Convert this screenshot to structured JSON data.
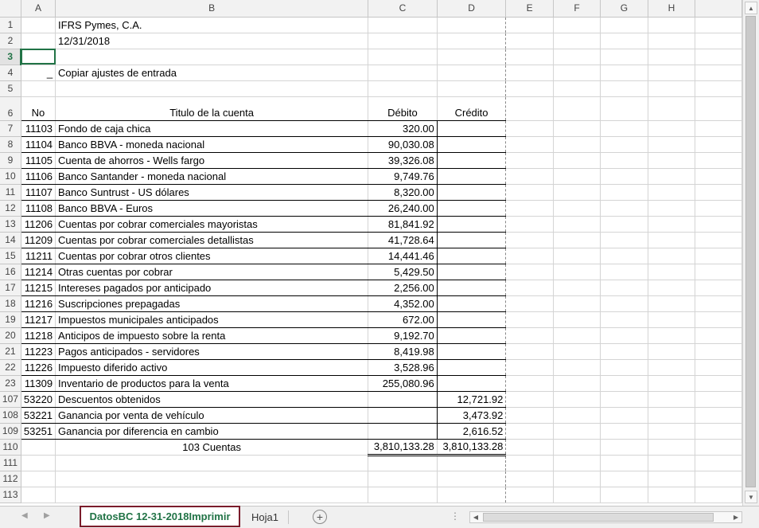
{
  "columns": [
    "A",
    "B",
    "C",
    "D",
    "E",
    "F",
    "G",
    "H"
  ],
  "company": "IFRS Pymes, C.A.",
  "date": "12/31/2018",
  "option_text": "Copiar ajustes de entrada",
  "option_marker": "_",
  "headers": {
    "no": "No",
    "titulo": "Titulo de la cuenta",
    "debito": "Débito",
    "credito": "Crédito"
  },
  "row_numbers": {
    "r1": "1",
    "r2": "2",
    "r3": "3",
    "r4": "4",
    "r5": "5",
    "r6": "6",
    "r110": "110",
    "r111": "111",
    "r112": "112",
    "r113": "113"
  },
  "accounts": [
    {
      "row": "7",
      "no": "11103",
      "name": "Fondo de caja chica",
      "debit": "320.00",
      "credit": ""
    },
    {
      "row": "8",
      "no": "11104",
      "name": "Banco BBVA - moneda nacional",
      "debit": "90,030.08",
      "credit": ""
    },
    {
      "row": "9",
      "no": "11105",
      "name": "Cuenta de ahorros - Wells fargo",
      "debit": "39,326.08",
      "credit": ""
    },
    {
      "row": "10",
      "no": "11106",
      "name": "Banco Santander - moneda nacional",
      "debit": "9,749.76",
      "credit": ""
    },
    {
      "row": "11",
      "no": "11107",
      "name": "Banco Suntrust - US dólares",
      "debit": "8,320.00",
      "credit": ""
    },
    {
      "row": "12",
      "no": "11108",
      "name": "Banco BBVA - Euros",
      "debit": "26,240.00",
      "credit": ""
    },
    {
      "row": "13",
      "no": "11206",
      "name": "Cuentas por cobrar comerciales mayoristas",
      "debit": "81,841.92",
      "credit": ""
    },
    {
      "row": "14",
      "no": "11209",
      "name": "Cuentas por cobrar comerciales detallistas",
      "debit": "41,728.64",
      "credit": ""
    },
    {
      "row": "15",
      "no": "11211",
      "name": "Cuentas por cobrar otros clientes",
      "debit": "14,441.46",
      "credit": ""
    },
    {
      "row": "16",
      "no": "11214",
      "name": "Otras cuentas por cobrar",
      "debit": "5,429.50",
      "credit": ""
    },
    {
      "row": "17",
      "no": "11215",
      "name": "Intereses pagados por anticipado",
      "debit": "2,256.00",
      "credit": ""
    },
    {
      "row": "18",
      "no": "11216",
      "name": "Suscripciones prepagadas",
      "debit": "4,352.00",
      "credit": ""
    },
    {
      "row": "19",
      "no": "11217",
      "name": "Impuestos municipales anticipados",
      "debit": "672.00",
      "credit": ""
    },
    {
      "row": "20",
      "no": "11218",
      "name": "Anticipos de impuesto sobre la renta",
      "debit": "9,192.70",
      "credit": ""
    },
    {
      "row": "21",
      "no": "11223",
      "name": "Pagos anticipados - servidores",
      "debit": "8,419.98",
      "credit": ""
    },
    {
      "row": "22",
      "no": "11226",
      "name": "Impuesto diferido activo",
      "debit": "3,528.96",
      "credit": ""
    },
    {
      "row": "23",
      "no": "11309",
      "name": "Inventario de productos para la venta",
      "debit": "255,080.96",
      "credit": ""
    },
    {
      "row": "107",
      "no": "53220",
      "name": "Descuentos obtenidos",
      "debit": "",
      "credit": "12,721.92"
    },
    {
      "row": "108",
      "no": "53221",
      "name": "Ganancia por venta de vehículo",
      "debit": "",
      "credit": "3,473.92"
    },
    {
      "row": "109",
      "no": "53251",
      "name": "Ganancia por diferencia en cambio",
      "debit": "",
      "credit": "2,616.52"
    }
  ],
  "totals": {
    "label": "103 Cuentas",
    "debit": "3,810,133.28",
    "credit": "3,810,133.28"
  },
  "tabs": {
    "active": "DatosBC 12-31-2018Imprimir",
    "other": "Hoja1",
    "add": "+"
  },
  "colors": {
    "accent": "#217346",
    "active_tab_border": "#7a1c2b"
  }
}
